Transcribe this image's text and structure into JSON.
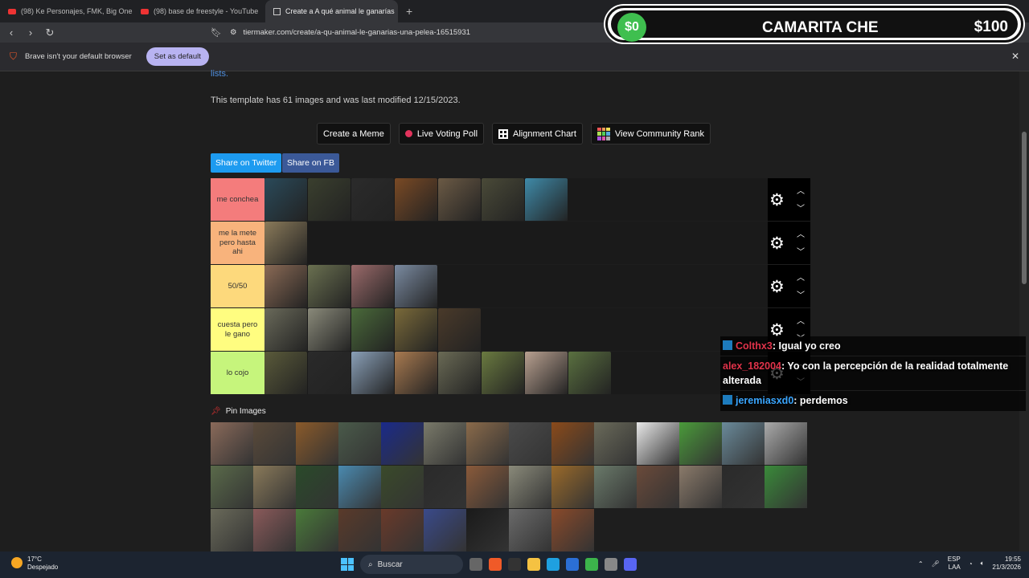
{
  "browser": {
    "tabs": [
      {
        "label": "(98) Ke Personajes, FMK, Big One",
        "type": "youtube"
      },
      {
        "label": "(98) base de freestyle - YouTube",
        "type": "youtube"
      },
      {
        "label": "Create a A qué animal le ganarías",
        "type": "tiermaker",
        "active": true
      }
    ],
    "url": "tiermaker.com/create/a-qu-animal-le-ganarias-una-pelea-16515931",
    "infobar_text": "Brave isn't your default browser",
    "set_default_label": "Set as default"
  },
  "overlay": {
    "left_amount": "$0",
    "title": "CAMARITA CHE",
    "right_amount": "$100"
  },
  "page": {
    "lists_link": "lists.",
    "template_info": "This template has 61 images and was last modified 12/15/2023.",
    "actions": {
      "create_meme": "Create a Meme",
      "live_poll": "Live Voting Poll",
      "alignment": "Alignment Chart",
      "community_rank": "View Community Rank"
    },
    "share_twitter": "Share on Twitter",
    "share_fb": "Share on FB",
    "pin_images": "Pin Images"
  },
  "tiers": [
    {
      "label": "me conchea",
      "color": "#f47c7c",
      "images": [
        "#2a4a5a",
        "#3a3f2e",
        "#2b2b2b",
        "#7a4a25",
        "#6b5a45",
        "#4a4a38",
        "#3f8aa8"
      ]
    },
    {
      "label": "me la mete pero hasta ahi",
      "color": "#f8b37c",
      "images": [
        "#8a7a5a"
      ]
    },
    {
      "label": "50/50",
      "color": "#fdd97c",
      "images": [
        "#8a6a55",
        "#6a7050",
        "#9a6a6a",
        "#7a8aa0"
      ]
    },
    {
      "label": "cuesta pero le gano",
      "color": "#fffd80",
      "images": [
        "#6a6a5a",
        "#8a8a7a",
        "#4a6a3a",
        "#7a6a3a",
        "#4a3a2a"
      ]
    },
    {
      "label": "lo cojo",
      "color": "#c6f57c",
      "images": [
        "#5a5a3a",
        "#2a2a2a",
        "#8aa0b8",
        "#a87a50",
        "#6a6a55",
        "#6a7a40",
        "#b8a090",
        "#5a7040"
      ]
    }
  ],
  "pool_images": [
    "#8a6a5a",
    "#5a4a3a",
    "#8a5a2a",
    "#4a5a4a",
    "#1a2a8a",
    "#7a7a6a",
    "#8a6a4a",
    "#4a4a4a",
    "#8a4a1a",
    "#6a6a5a",
    "#e8e8e8",
    "#4a9a3a",
    "#6a8a9a",
    "#aaa",
    "#5a6a4a",
    "#8a7a5a",
    "#2a4a2a",
    "#4a8ab0",
    "#3a4a2a",
    "#2a2a2a",
    "#8a5a3a",
    "#8a8a7a",
    "#9a6a2a",
    "#6a7a6a",
    "#6a4a3a",
    "#8a7a6a",
    "#2a2a2a",
    "#3a8a3a",
    "#6a6a5a",
    "#8a5a5a",
    "#4a7a3a",
    "#5a3a2a",
    "#6a3a2a",
    "#3a4a8a",
    "#1a1a1a",
    "#6a6a6a",
    "#8a4a2a"
  ],
  "chat": [
    {
      "user": "Colthx3",
      "msg": ": Igual yo creo",
      "platform": "kick"
    },
    {
      "user": "alex_182004",
      "msg": ": Yo con la percepción de la realidad totalmente alterada",
      "platform": "none"
    },
    {
      "user": "jeremiasxd0",
      "msg": ": perdemos",
      "platform": "kick"
    }
  ],
  "taskbar": {
    "temp": "17°C",
    "weather": "Despejado",
    "search": "Buscar",
    "lang1": "ESP",
    "lang2": "LAA",
    "time": "19:55",
    "date": "21/3/2026"
  }
}
